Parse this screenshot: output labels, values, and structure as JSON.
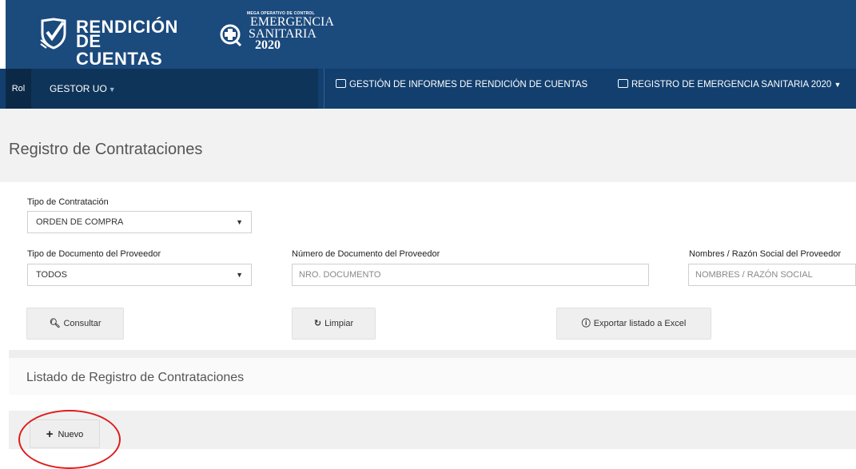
{
  "header": {
    "logo_rendicion_line1": "RENDICIÓN",
    "logo_rendicion_line2": "DE CUENTAS",
    "logo_emergencia_small": "MEGA OPERATIVO DE CONTROL",
    "logo_emergencia_line1": "EMERGENCIA",
    "logo_emergencia_line2": "SANITARIA",
    "logo_emergencia_year": "2020"
  },
  "nav": {
    "rol_label": "Rol",
    "role_value": "GESTOR UO",
    "item1": "GESTIÓN DE INFORMES DE RENDICIÓN DE CUENTAS",
    "item2": "REGISTRO DE EMERGENCIA SANITARIA 2020"
  },
  "page": {
    "title": "Registro de Contrataciones"
  },
  "filters": {
    "tipo_contratacion_label": "Tipo de Contratación",
    "tipo_contratacion_value": "ORDEN DE COMPRA",
    "tipo_documento_label": "Tipo de Documento del Proveedor",
    "tipo_documento_value": "TODOS",
    "numero_documento_label": "Número de Documento del Proveedor",
    "numero_documento_placeholder": "NRO. DOCUMENTO",
    "nombres_label": "Nombres / Razón Social del Proveedor",
    "nombres_placeholder": "NOMBRES / RAZÓN SOCIAL"
  },
  "actions": {
    "consultar": "Consultar",
    "limpiar": "Limpiar",
    "exportar": "Exportar listado a Excel"
  },
  "listado": {
    "title": "Listado de Registro de Contrataciones",
    "nuevo": "Nuevo"
  },
  "colors": {
    "header_bg": "#1b4a7d",
    "navbar_bg": "#123f6e",
    "highlight": "#e01b1b"
  },
  "icons": {
    "consultar": "search-icon",
    "limpiar": "refresh-icon",
    "exportar": "info-circle-icon",
    "nuevo": "plus-icon",
    "nav": "monitor-icon"
  }
}
